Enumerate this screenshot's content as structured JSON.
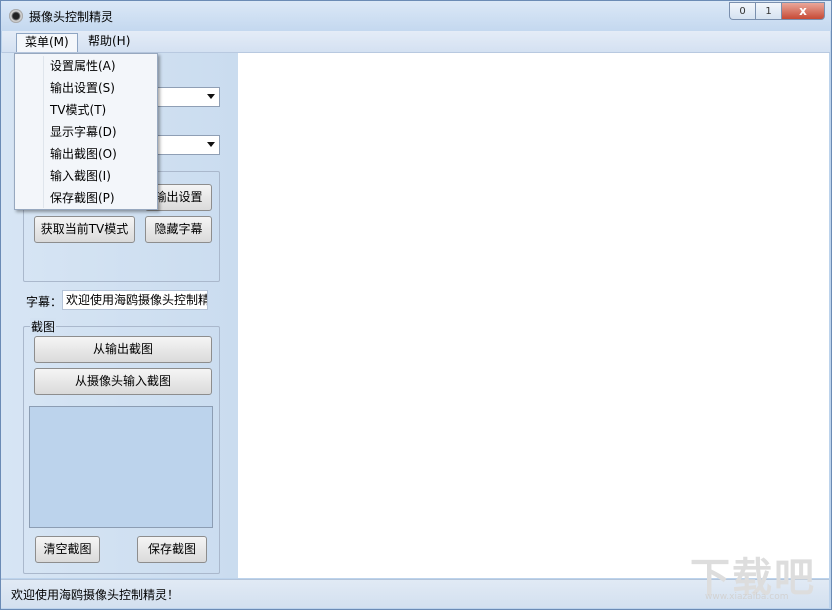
{
  "window": {
    "title": "摄像头控制精灵",
    "minimize": "0",
    "maximize": "1",
    "close": "x"
  },
  "menubar": {
    "menu": "菜单(M)",
    "help": "帮助(H)"
  },
  "menu_dropdown": {
    "items": [
      "设置属性(A)",
      "输出设置(S)",
      "TV模式(T)",
      "显示字幕(D)",
      "输出截图(O)",
      "输入截图(I)",
      "保存截图(P)"
    ]
  },
  "left_panel": {
    "output_settings_button": "输出设置",
    "get_tv_mode_button": "获取当前TV模式",
    "hide_caption_button": "隐藏字幕",
    "caption_label": "字幕：",
    "caption_value": "欢迎使用海鸥摄像头控制精灵",
    "screenshot_group_label": "截图",
    "from_output_button": "从输出截图",
    "from_camera_button": "从摄像头输入截图",
    "clear_button": "清空截图",
    "save_button": "保存截图"
  },
  "statusbar": {
    "text": "欢迎使用海鸥摄像头控制精灵！"
  },
  "watermark": {
    "text": "下载吧",
    "sub": "www.xiazaiba.com"
  }
}
